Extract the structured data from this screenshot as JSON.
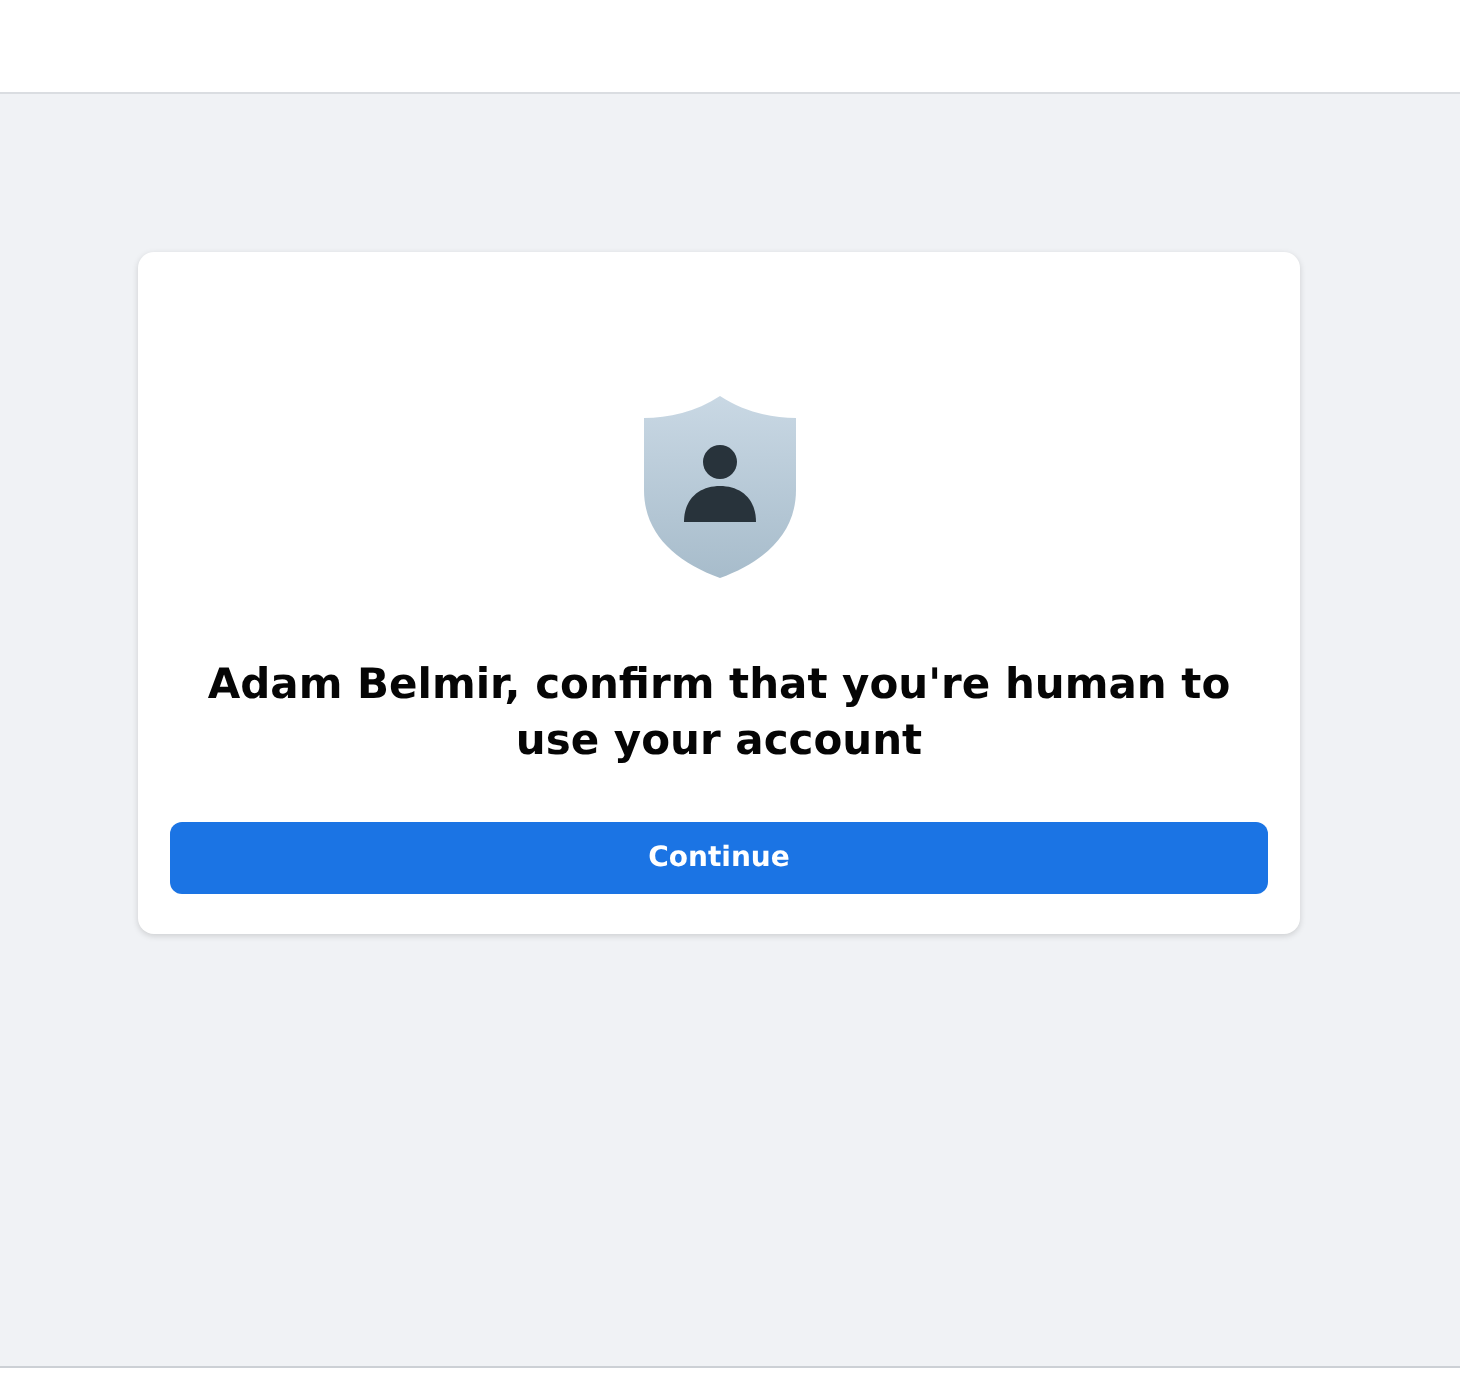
{
  "dialog": {
    "heading": "Adam Belmir, confirm that you're human to use your account",
    "button": "Continue"
  }
}
